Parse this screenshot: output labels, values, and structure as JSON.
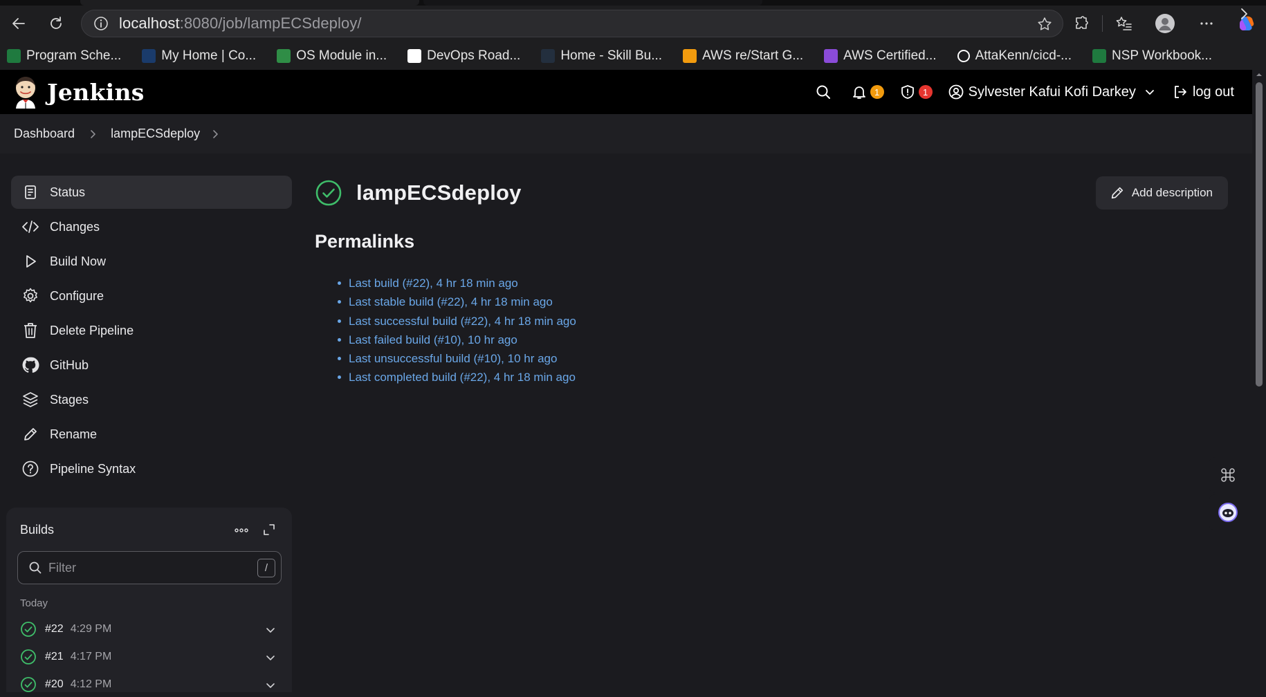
{
  "browser": {
    "url_host": "localhost",
    "url_path": ":8080/job/lampECSdeploy/",
    "bookmarks": [
      {
        "label": "Program Sche...",
        "icon": "excel-icon",
        "color": "#1f7a3f"
      },
      {
        "label": "My Home | Co...",
        "icon": "coursera-icon",
        "color": "#1a3b6b"
      },
      {
        "label": "OS Module in...",
        "icon": "geeksforgeeks-icon",
        "color": "#2f8d46"
      },
      {
        "label": "DevOps Road...",
        "icon": "roadmap-icon",
        "color": "#ffffff"
      },
      {
        "label": "Home - Skill Bu...",
        "icon": "aws-icon",
        "color": "#232f3e"
      },
      {
        "label": "AWS re/Start G...",
        "icon": "aws-restart-icon",
        "color": "#f29b0e"
      },
      {
        "label": "AWS Certified...",
        "icon": "aws-cert-icon",
        "color": "#8a4bd8"
      },
      {
        "label": "AttaKenn/cicd-...",
        "icon": "github-icon",
        "color": "#ffffff"
      },
      {
        "label": "NSP Workbook...",
        "icon": "excel-icon",
        "color": "#1f7a3f"
      }
    ]
  },
  "header": {
    "brand": "Jenkins",
    "notifications_count": "1",
    "security_count": "1",
    "user_name": "Sylvester Kafui Kofi Darkey",
    "logout_label": "log out"
  },
  "breadcrumb": {
    "items": [
      "Dashboard",
      "lampECSdeploy"
    ]
  },
  "sidebar": {
    "tasks": [
      {
        "label": "Status",
        "icon": "status-icon"
      },
      {
        "label": "Changes",
        "icon": "code-icon"
      },
      {
        "label": "Build Now",
        "icon": "play-icon"
      },
      {
        "label": "Configure",
        "icon": "gear-icon"
      },
      {
        "label": "Delete Pipeline",
        "icon": "trash-icon"
      },
      {
        "label": "GitHub",
        "icon": "github-icon"
      },
      {
        "label": "Stages",
        "icon": "layers-icon"
      },
      {
        "label": "Rename",
        "icon": "pencil-icon"
      },
      {
        "label": "Pipeline Syntax",
        "icon": "help-icon"
      }
    ]
  },
  "builds": {
    "title": "Builds",
    "filter_placeholder": "Filter",
    "filter_shortcut": "/",
    "group_label": "Today",
    "items": [
      {
        "number": "#22",
        "time": "4:29 PM"
      },
      {
        "number": "#21",
        "time": "4:17 PM"
      },
      {
        "number": "#20",
        "time": "4:12 PM"
      }
    ]
  },
  "main": {
    "job_name": "lampECSdeploy",
    "add_description_label": "Add description",
    "permalinks_heading": "Permalinks",
    "permalinks": [
      "Last build (#22), 4 hr 18 min ago",
      "Last stable build (#22), 4 hr 18 min ago",
      "Last successful build (#22), 4 hr 18 min ago",
      "Last failed build (#10), 10 hr ago",
      "Last unsuccessful build (#10), 10 hr ago",
      "Last completed build (#22), 4 hr 18 min ago"
    ]
  },
  "colors": {
    "success": "#3fbe6a",
    "link": "#6aa7e8",
    "notification_badge": "#f29b0e",
    "security_badge": "#e5352f"
  }
}
